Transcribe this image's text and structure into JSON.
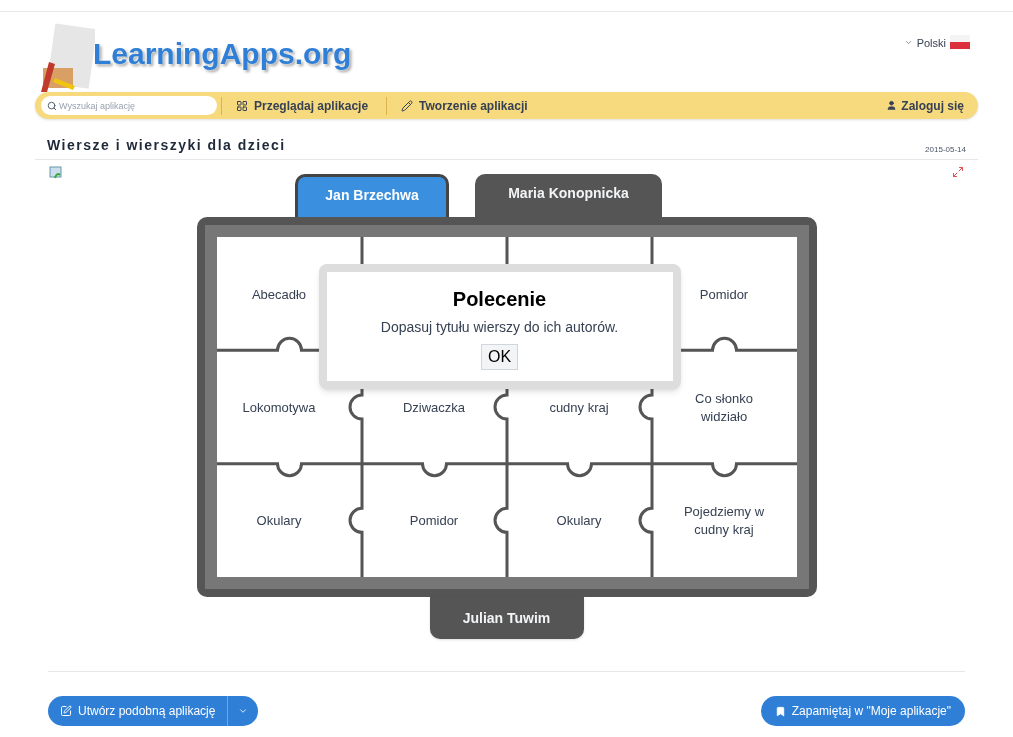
{
  "header": {
    "logo": "LearningApps.org",
    "language": "Polski"
  },
  "nav": {
    "search_placeholder": "Wyszukaj aplikację",
    "items": [
      {
        "label": "Przeglądaj aplikacje",
        "kind": "grid"
      },
      {
        "label": "Tworzenie aplikacji",
        "kind": "pencil"
      }
    ],
    "login": "Zaloguj się"
  },
  "page": {
    "title": "Wiersze i wierszyki dla dzieci",
    "date": "2015-05-14"
  },
  "categories": [
    {
      "label": "Jan Brzechwa",
      "selected": true
    },
    {
      "label": "Maria Konopnicka",
      "selected": false
    }
  ],
  "bottom_category": {
    "label": "Julian Tuwim"
  },
  "tiles": [
    [
      {
        "text": "Abecadło"
      },
      {
        "covered": true
      },
      {
        "covered": true
      },
      {
        "text": "Pomidor"
      }
    ],
    [
      {
        "text": "Lokomotywa"
      },
      {
        "text": "Dziwaczka"
      },
      {
        "text": "cudny kraj"
      },
      {
        "text": "Co słonko\nwidziało"
      }
    ],
    [
      {
        "text": "Okulary"
      },
      {
        "text": "Pomidor"
      },
      {
        "text": "Okulary"
      },
      {
        "text": "Pojedziemy w\ncudny kraj"
      }
    ]
  ],
  "dialog": {
    "title": "Polecenie",
    "message": "Dopasuj tytułu wierszy do ich autorów.",
    "button": "OK"
  },
  "footer": {
    "create": "Utwórz podobną aplikację",
    "save": "Zapamiętaj w \"Moje aplikacje\""
  }
}
